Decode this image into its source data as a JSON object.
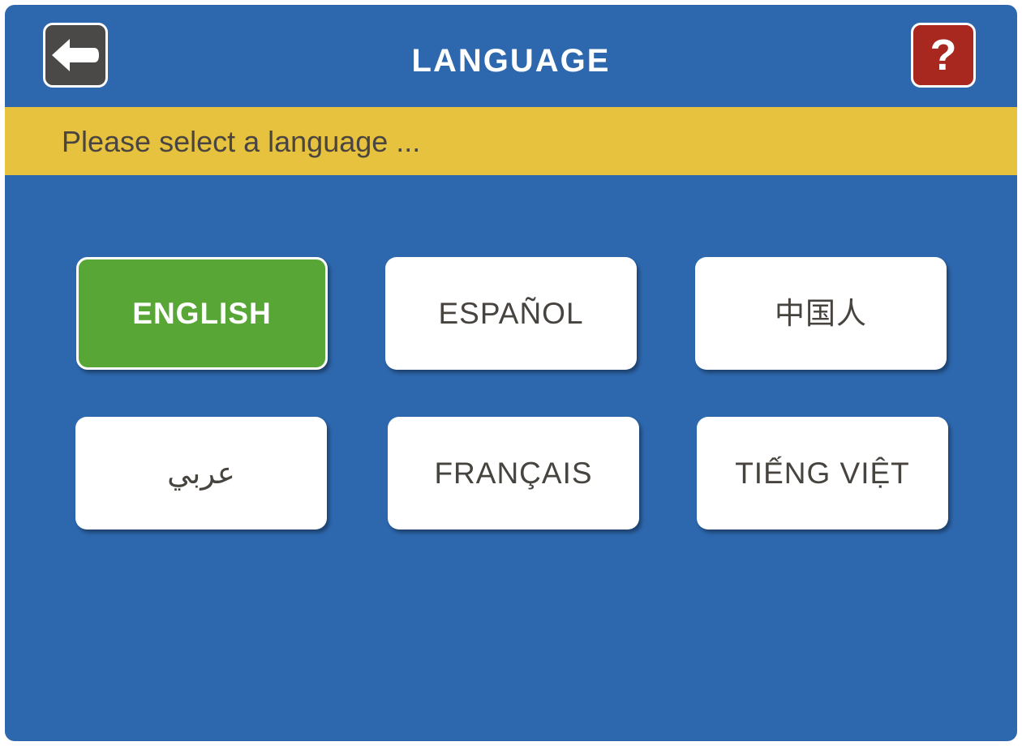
{
  "header": {
    "title": "LANGUAGE",
    "back_button": {
      "icon": "back-arrow-icon"
    },
    "help_button": {
      "label": "?",
      "icon": "question-mark-icon"
    }
  },
  "banner": {
    "text": "Please select a language ..."
  },
  "languages": [
    {
      "label": "ENGLISH",
      "selected": true
    },
    {
      "label": "ESPAÑOL",
      "selected": false
    },
    {
      "label": "中国人",
      "selected": false
    },
    {
      "label": "عربي",
      "selected": false
    },
    {
      "label": "FRANÇAIS",
      "selected": false
    },
    {
      "label": "TIẾNG VIỆT",
      "selected": false
    }
  ],
  "colors": {
    "background": "#2d67ad",
    "banner": "#e6c23e",
    "selected": "#58a736",
    "back_button": "#4a4947",
    "help_button": "#a8281f"
  }
}
